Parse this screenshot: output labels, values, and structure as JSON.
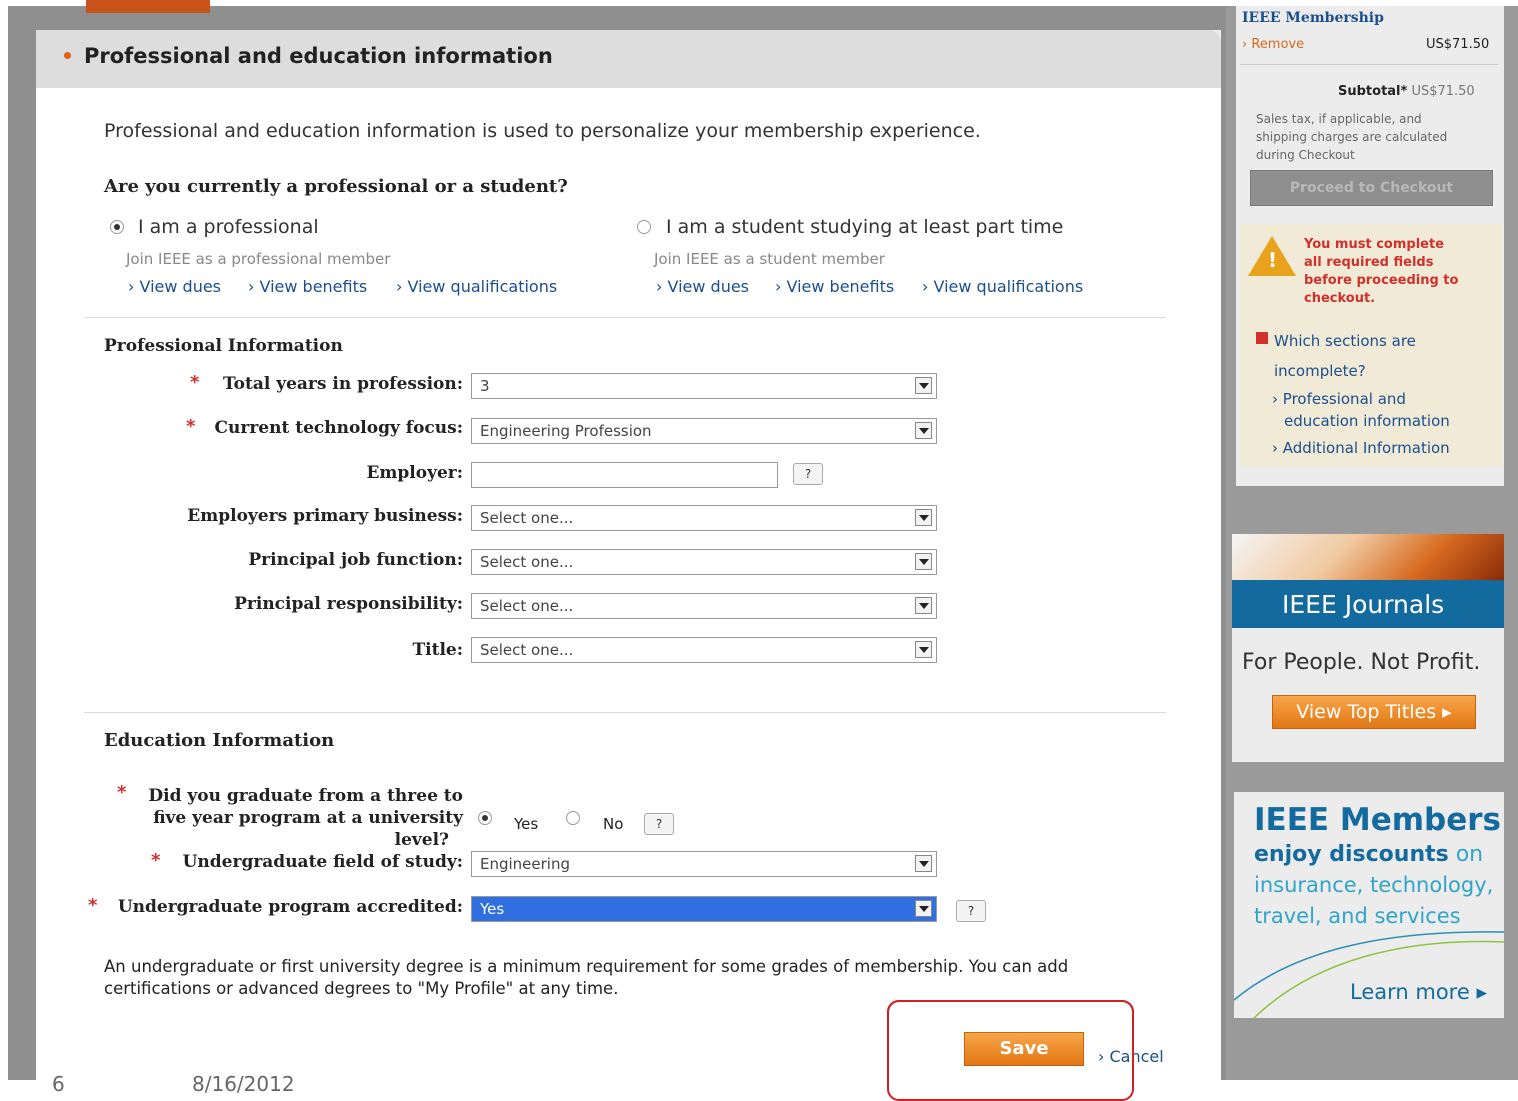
{
  "section": {
    "title": "Professional and education information"
  },
  "intro": "Professional and education information is used to personalize your membership experience.",
  "question": "Are you currently a professional or a student?",
  "options": [
    {
      "label": "I am a professional",
      "sub": "Join IEEE as a professional member",
      "selected": true,
      "links": [
        "View dues",
        "View benefits",
        "View qualifications"
      ]
    },
    {
      "label": "I am a student studying at least part time",
      "sub": "Join IEEE as a student member",
      "selected": false,
      "links": [
        "View dues",
        "View benefits",
        "View qualifications"
      ]
    }
  ],
  "professional": {
    "heading": "Professional Information",
    "fields": {
      "years": {
        "label": "Total years in profession:",
        "value": "3"
      },
      "focus": {
        "label": "Current technology focus:",
        "value": "Engineering Profession"
      },
      "employer": {
        "label": "Employer:",
        "value": ""
      },
      "business": {
        "label": "Employers primary business:",
        "value": "Select one..."
      },
      "job": {
        "label": "Principal job function:",
        "value": "Select one..."
      },
      "resp": {
        "label": "Principal responsibility:",
        "value": "Select one..."
      },
      "title": {
        "label": "Title:",
        "value": "Select one..."
      }
    }
  },
  "education": {
    "heading": "Education Information",
    "graduate_question": [
      "Did you graduate from a three to",
      "five year program at a university",
      "level?"
    ],
    "yes": "Yes",
    "no": "No",
    "field_label": "Undergraduate field of study:",
    "field_value": "Engineering",
    "accredited_label": "Undergraduate program accredited:",
    "accredited_value": "Yes",
    "note": "An undergraduate or first university degree is a minimum requirement for some grades of membership. You can add certifications or advanced degrees to \"My Profile\" at any time."
  },
  "help_label": "?",
  "actions": {
    "save": "Save",
    "cancel": "Cancel"
  },
  "sidebar": {
    "membership": "IEEE Membership",
    "remove": "Remove",
    "price": "US$71.50",
    "subtotal_label": "Subtotal*",
    "subtotal_value": "US$71.50",
    "tax_note": [
      "Sales tax, if applicable, and",
      "shipping charges are calculated",
      "during Checkout"
    ],
    "checkout": "Proceed to Checkout",
    "warning": [
      "You must complete",
      "all required fields",
      "before proceeding to",
      "checkout."
    ],
    "sections_q": [
      "Which sections are",
      "incomplete?"
    ],
    "incomplete": [
      [
        "Professional and",
        "education information"
      ],
      [
        "Additional Information"
      ]
    ],
    "journals_title": "IEEE Journals",
    "journals_tag": "For People. Not Profit.",
    "journals_btn": "View Top Titles",
    "members_title": "IEEE Members",
    "members_bold": "enjoy discounts",
    "members_on": "on",
    "members_l2": "insurance, technology,",
    "members_l3": "travel, and services",
    "learn_more": "Learn more"
  },
  "footer": {
    "page": "6",
    "date": "8/16/2012"
  },
  "colors": {
    "accent_orange": "#e27613",
    "link_blue": "#1a4f8f",
    "required_red": "#d0312d",
    "journals_blue": "#136a9e"
  }
}
